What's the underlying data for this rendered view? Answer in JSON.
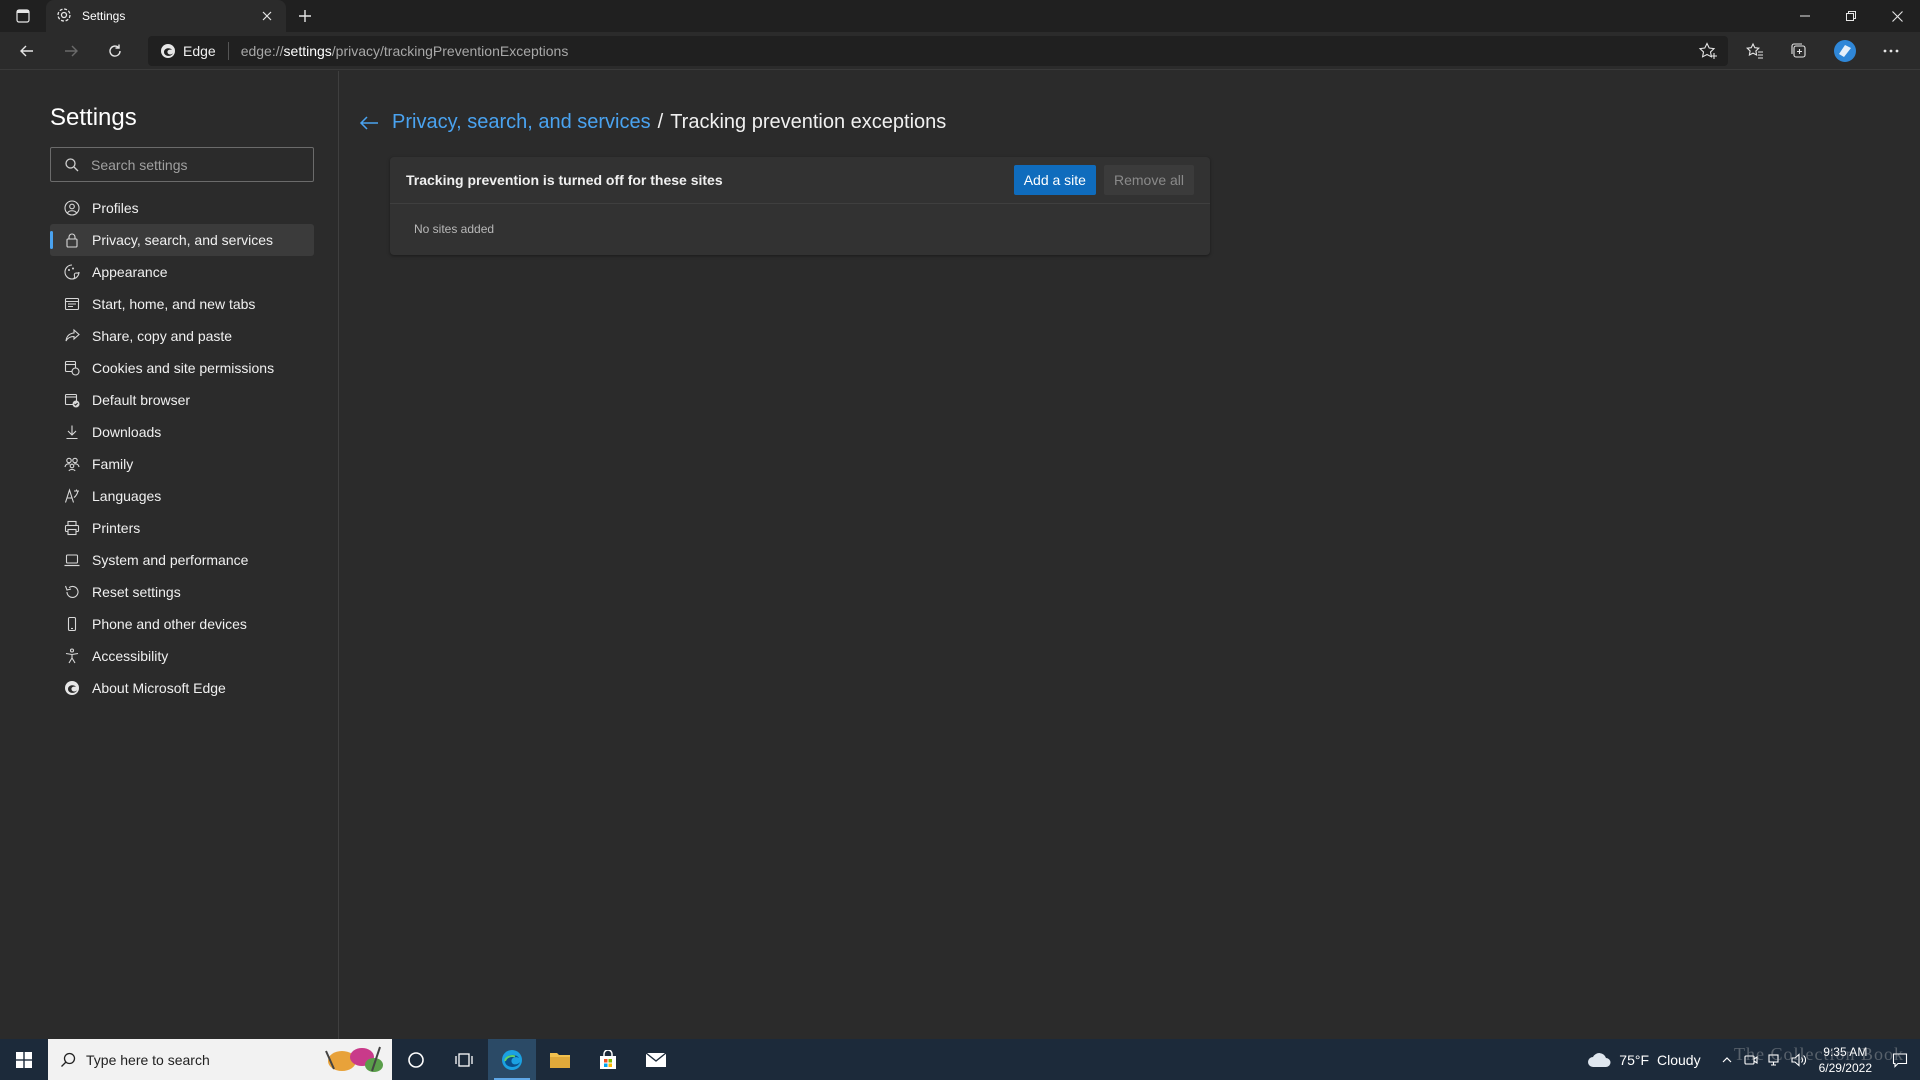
{
  "browser": {
    "tab_title": "Settings",
    "site_label": "Edge",
    "url_prefix": "edge://",
    "url_highlight": "settings",
    "url_rest": "/privacy/trackingPreventionExceptions"
  },
  "sidebar": {
    "title": "Settings",
    "search_placeholder": "Search settings",
    "items": [
      {
        "label": "Profiles",
        "icon": "profile-icon"
      },
      {
        "label": "Privacy, search, and services",
        "icon": "lock-icon",
        "active": true
      },
      {
        "label": "Appearance",
        "icon": "appearance-icon"
      },
      {
        "label": "Start, home, and new tabs",
        "icon": "start-page-icon"
      },
      {
        "label": "Share, copy and paste",
        "icon": "share-icon"
      },
      {
        "label": "Cookies and site permissions",
        "icon": "cookies-icon"
      },
      {
        "label": "Default browser",
        "icon": "default-browser-icon"
      },
      {
        "label": "Downloads",
        "icon": "download-icon"
      },
      {
        "label": "Family",
        "icon": "family-icon"
      },
      {
        "label": "Languages",
        "icon": "languages-icon"
      },
      {
        "label": "Printers",
        "icon": "printer-icon"
      },
      {
        "label": "System and performance",
        "icon": "laptop-icon"
      },
      {
        "label": "Reset settings",
        "icon": "reset-icon"
      },
      {
        "label": "Phone and other devices",
        "icon": "phone-icon"
      },
      {
        "label": "Accessibility",
        "icon": "accessibility-icon"
      },
      {
        "label": "About Microsoft Edge",
        "icon": "edge-logo-icon"
      }
    ]
  },
  "main": {
    "breadcrumb_parent": "Privacy, search, and services",
    "breadcrumb_separator": "/",
    "breadcrumb_current": "Tracking prevention exceptions",
    "card_title": "Tracking prevention is turned off for these sites",
    "add_button": "Add a site",
    "remove_button": "Remove all",
    "empty_text": "No sites added"
  },
  "taskbar": {
    "search_placeholder": "Type here to search",
    "weather_temp": "75°F",
    "weather_text": "Cloudy",
    "time": "9:35 AM",
    "date": "6/29/2022",
    "watermark": "The Collection Book"
  },
  "colors": {
    "accent": "#4aa3f0",
    "button_primary": "#0f6cbd",
    "background": "#2b2b2b",
    "taskbar": "#1c2a3a"
  }
}
